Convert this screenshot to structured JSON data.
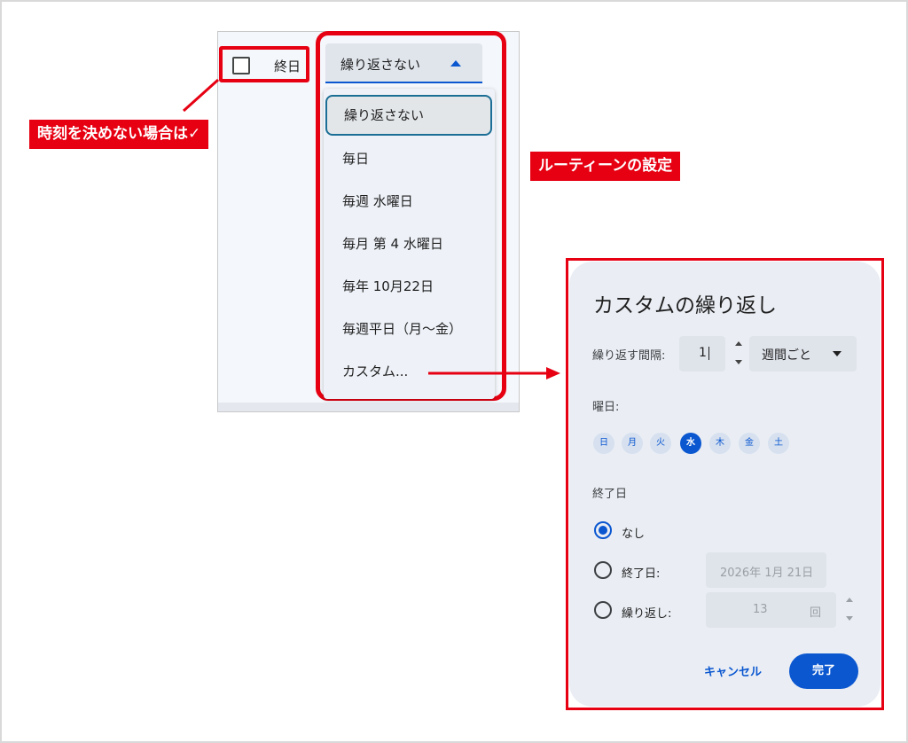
{
  "event_form": {
    "all_day_label": "終日",
    "all_day_checked": false,
    "repeat_selected": "繰り返さない"
  },
  "repeat_menu": {
    "items": [
      "繰り返さない",
      "毎日",
      "毎週 水曜日",
      "毎月 第 4 水曜日",
      "毎年 10月22日",
      "毎週平日（月～金）",
      "カスタム..."
    ]
  },
  "callouts": {
    "all_day": "時刻を決めない場合は✓",
    "routine": "ルーティーンの設定"
  },
  "custom_dialog": {
    "title": "カスタムの繰り返し",
    "interval_label": "繰り返す間隔:",
    "interval_value": "1",
    "interval_unit": "週間ごと",
    "weekdays_label": "曜日:",
    "weekdays": [
      "日",
      "月",
      "火",
      "水",
      "木",
      "金",
      "土"
    ],
    "selected_weekday": "水",
    "end_label": "終了日",
    "end_options": {
      "never": "なし",
      "on_date": "終了日:",
      "after": "繰り返し:"
    },
    "selected_end_option": "なし",
    "end_date_value": "2026年 1月 21日",
    "occurrences_value": "13",
    "occurrences_unit": "回",
    "cancel_label": "キャンセル",
    "done_label": "完了"
  },
  "colors": {
    "accent": "#0b57d0",
    "annotation": "#e60012"
  }
}
